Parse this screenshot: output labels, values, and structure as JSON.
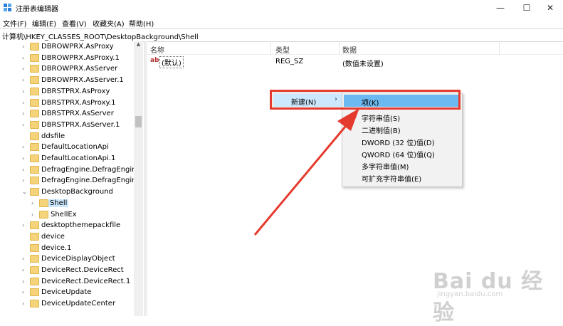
{
  "window": {
    "title": "注册表编辑器",
    "minimize": "—",
    "maximize": "☐",
    "close": "✕"
  },
  "menu": [
    "文件(F)",
    "编辑(E)",
    "查看(V)",
    "收藏夹(A)",
    "帮助(H)"
  ],
  "address": "计算机\\HKEY_CLASSES_ROOT\\DesktopBackground\\Shell",
  "tree": [
    {
      "label": "DBROWPRX.AsProxy",
      "indent": 0,
      "expandable": true
    },
    {
      "label": "DBROWPRX.AsProxy.1",
      "indent": 0,
      "expandable": true
    },
    {
      "label": "DBROWPRX.AsServer",
      "indent": 0,
      "expandable": true
    },
    {
      "label": "DBROWPRX.AsServer.1",
      "indent": 0,
      "expandable": true
    },
    {
      "label": "DBRSTPRX.AsProxy",
      "indent": 0,
      "expandable": true
    },
    {
      "label": "DBRSTPRX.AsProxy.1",
      "indent": 0,
      "expandable": true
    },
    {
      "label": "DBRSTPRX.AsServer",
      "indent": 0,
      "expandable": true
    },
    {
      "label": "DBRSTPRX.AsServer.1",
      "indent": 0,
      "expandable": true
    },
    {
      "label": "ddsfile",
      "indent": 0,
      "expandable": false
    },
    {
      "label": "DefaultLocationApi",
      "indent": 0,
      "expandable": true
    },
    {
      "label": "DefaultLocationApi.1",
      "indent": 0,
      "expandable": true
    },
    {
      "label": "DefragEngine.DefragEngine",
      "indent": 0,
      "expandable": true
    },
    {
      "label": "DefragEngine.DefragEngine.",
      "indent": 0,
      "expandable": true
    },
    {
      "label": "DesktopBackground",
      "indent": 0,
      "expandable": true,
      "expanded": true
    },
    {
      "label": "Shell",
      "indent": 1,
      "expandable": true,
      "selected": true
    },
    {
      "label": "ShellEx",
      "indent": 1,
      "expandable": true
    },
    {
      "label": "desktopthemepackfile",
      "indent": 0,
      "expandable": true
    },
    {
      "label": "device",
      "indent": 0,
      "expandable": false
    },
    {
      "label": "device.1",
      "indent": 0,
      "expandable": false
    },
    {
      "label": "DeviceDisplayObject",
      "indent": 0,
      "expandable": true
    },
    {
      "label": "DeviceRect.DeviceRect",
      "indent": 0,
      "expandable": true
    },
    {
      "label": "DeviceRect.DeviceRect.1",
      "indent": 0,
      "expandable": true
    },
    {
      "label": "DeviceUpdate",
      "indent": 0,
      "expandable": true
    },
    {
      "label": "DeviceUpdateCenter",
      "indent": 0,
      "expandable": true
    }
  ],
  "columns": {
    "name": "名称",
    "type": "类型",
    "data": "数据"
  },
  "values": [
    {
      "icon": "ab",
      "name": "(默认)",
      "type": "REG_SZ",
      "data": "(数值未设置)"
    }
  ],
  "context_menu": {
    "item": "新建(N)",
    "arrow": "›"
  },
  "submenu": {
    "items": [
      "项(K)",
      "字符串值(S)",
      "二进制值(B)",
      "DWORD (32 位)值(D)",
      "QWORD (64 位)值(Q)",
      "多字符串值(M)",
      "可扩充字符串值(E)"
    ],
    "highlighted_index": 0
  },
  "annotation_color": "#e53b2e",
  "watermark": {
    "main": "Bai du 经验",
    "sub": "jingyan.baidu.com"
  }
}
